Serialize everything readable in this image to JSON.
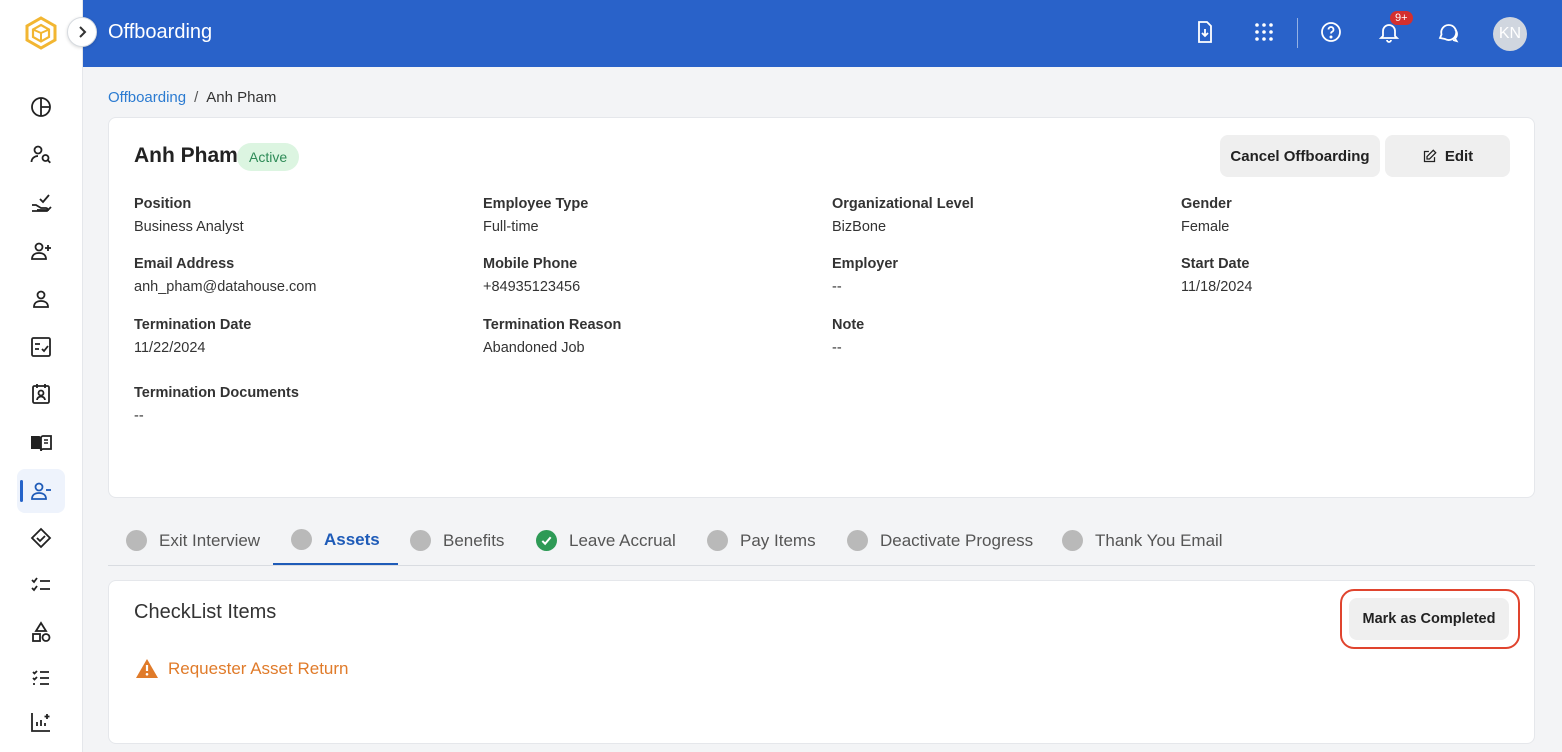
{
  "header": {
    "title": "Offboarding",
    "notification_count": "9+",
    "avatar_initials": "KN"
  },
  "breadcrumb": {
    "parent": "Offboarding",
    "separator": "/",
    "current": "Anh Pham"
  },
  "employee": {
    "name": "Anh Pham",
    "status": "Active",
    "cancel_label": "Cancel Offboarding",
    "edit_label": "Edit",
    "fields": [
      {
        "label": "Position",
        "value": "Business Analyst"
      },
      {
        "label": "Employee Type",
        "value": "Full-time"
      },
      {
        "label": "Organizational Level",
        "value": "BizBone"
      },
      {
        "label": "Gender",
        "value": "Female"
      },
      {
        "label": "Email Address",
        "value": "anh_pham@datahouse.com"
      },
      {
        "label": "Mobile Phone",
        "value": "+84935123456"
      },
      {
        "label": "Employer",
        "value": "--"
      },
      {
        "label": "Start Date",
        "value": "11/18/2024"
      },
      {
        "label": "Termination Date",
        "value": "11/22/2024"
      },
      {
        "label": "Termination Reason",
        "value": "Abandoned Job"
      },
      {
        "label": "Note",
        "value": "--"
      },
      {
        "label": "Termination Documents",
        "value": "--"
      }
    ]
  },
  "tabs": [
    {
      "label": "Exit Interview",
      "state": "pending"
    },
    {
      "label": "Assets",
      "state": "active"
    },
    {
      "label": "Benefits",
      "state": "pending"
    },
    {
      "label": "Leave Accrual",
      "state": "completed"
    },
    {
      "label": "Pay Items",
      "state": "pending"
    },
    {
      "label": "Deactivate Progress",
      "state": "pending"
    },
    {
      "label": "Thank You Email",
      "state": "pending"
    }
  ],
  "checklist": {
    "title": "CheckList Items",
    "mark_completed_label": "Mark as Completed",
    "items": [
      {
        "label": "Requester Asset Return",
        "icon": "warning-icon"
      }
    ]
  },
  "colors": {
    "header_bg": "#2962c9",
    "active_tab": "#1e5bb8",
    "status_green": "#2e8b57",
    "warning_orange": "#e07b2a",
    "highlight_red": "#e0442e"
  }
}
